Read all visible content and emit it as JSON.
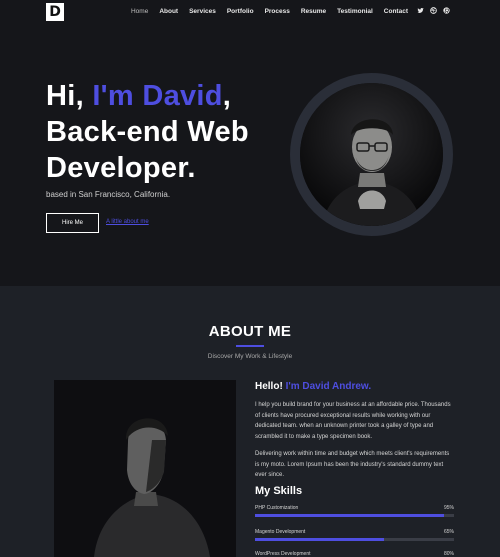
{
  "logo": {
    "letter": "D"
  },
  "nav": {
    "items": [
      {
        "label": "Home",
        "active": true
      },
      {
        "label": "About"
      },
      {
        "label": "Services"
      },
      {
        "label": "Portfolio"
      },
      {
        "label": "Process"
      },
      {
        "label": "Resume"
      },
      {
        "label": "Testimonial"
      },
      {
        "label": "Contact"
      }
    ],
    "socials": [
      "twitter-icon",
      "dribbble-icon",
      "github-icon"
    ]
  },
  "hero": {
    "greeting": "Hi, ",
    "name": "I'm David",
    "comma": ",",
    "line2": "Back-end Web",
    "line3": "Developer.",
    "based": "based in San Francisco, California.",
    "hire_label": "Hire Me",
    "little_label": "A little about me"
  },
  "about": {
    "title": "ABOUT ME",
    "subtitle": "Discover My Work & Lifestyle",
    "hello": "Hello! ",
    "hello_name": "I'm David Andrew.",
    "p1": "I help you build brand for your business at an affordable price. Thousands of clients have procured exceptional results while working with our dedicated team. when an unknown printer took a galley of type and scrambled it to make a type specimen book.",
    "p2": "Delivering work within time and budget which meets client's requirements is my moto. Lorem Ipsum has been the industry's standard dummy text ever since.",
    "skills_title": "My Skills",
    "skills": [
      {
        "name": "PHP Customization",
        "value": "95%",
        "level": 0.95
      },
      {
        "name": "Magento Development",
        "value": "65%",
        "level": 0.65
      },
      {
        "name": "WordPress Development",
        "value": "80%",
        "level": 0.8
      }
    ]
  },
  "colors": {
    "accent": "#4e4ee0",
    "hero_bg": "#15161a",
    "about_bg": "#1e2127"
  }
}
